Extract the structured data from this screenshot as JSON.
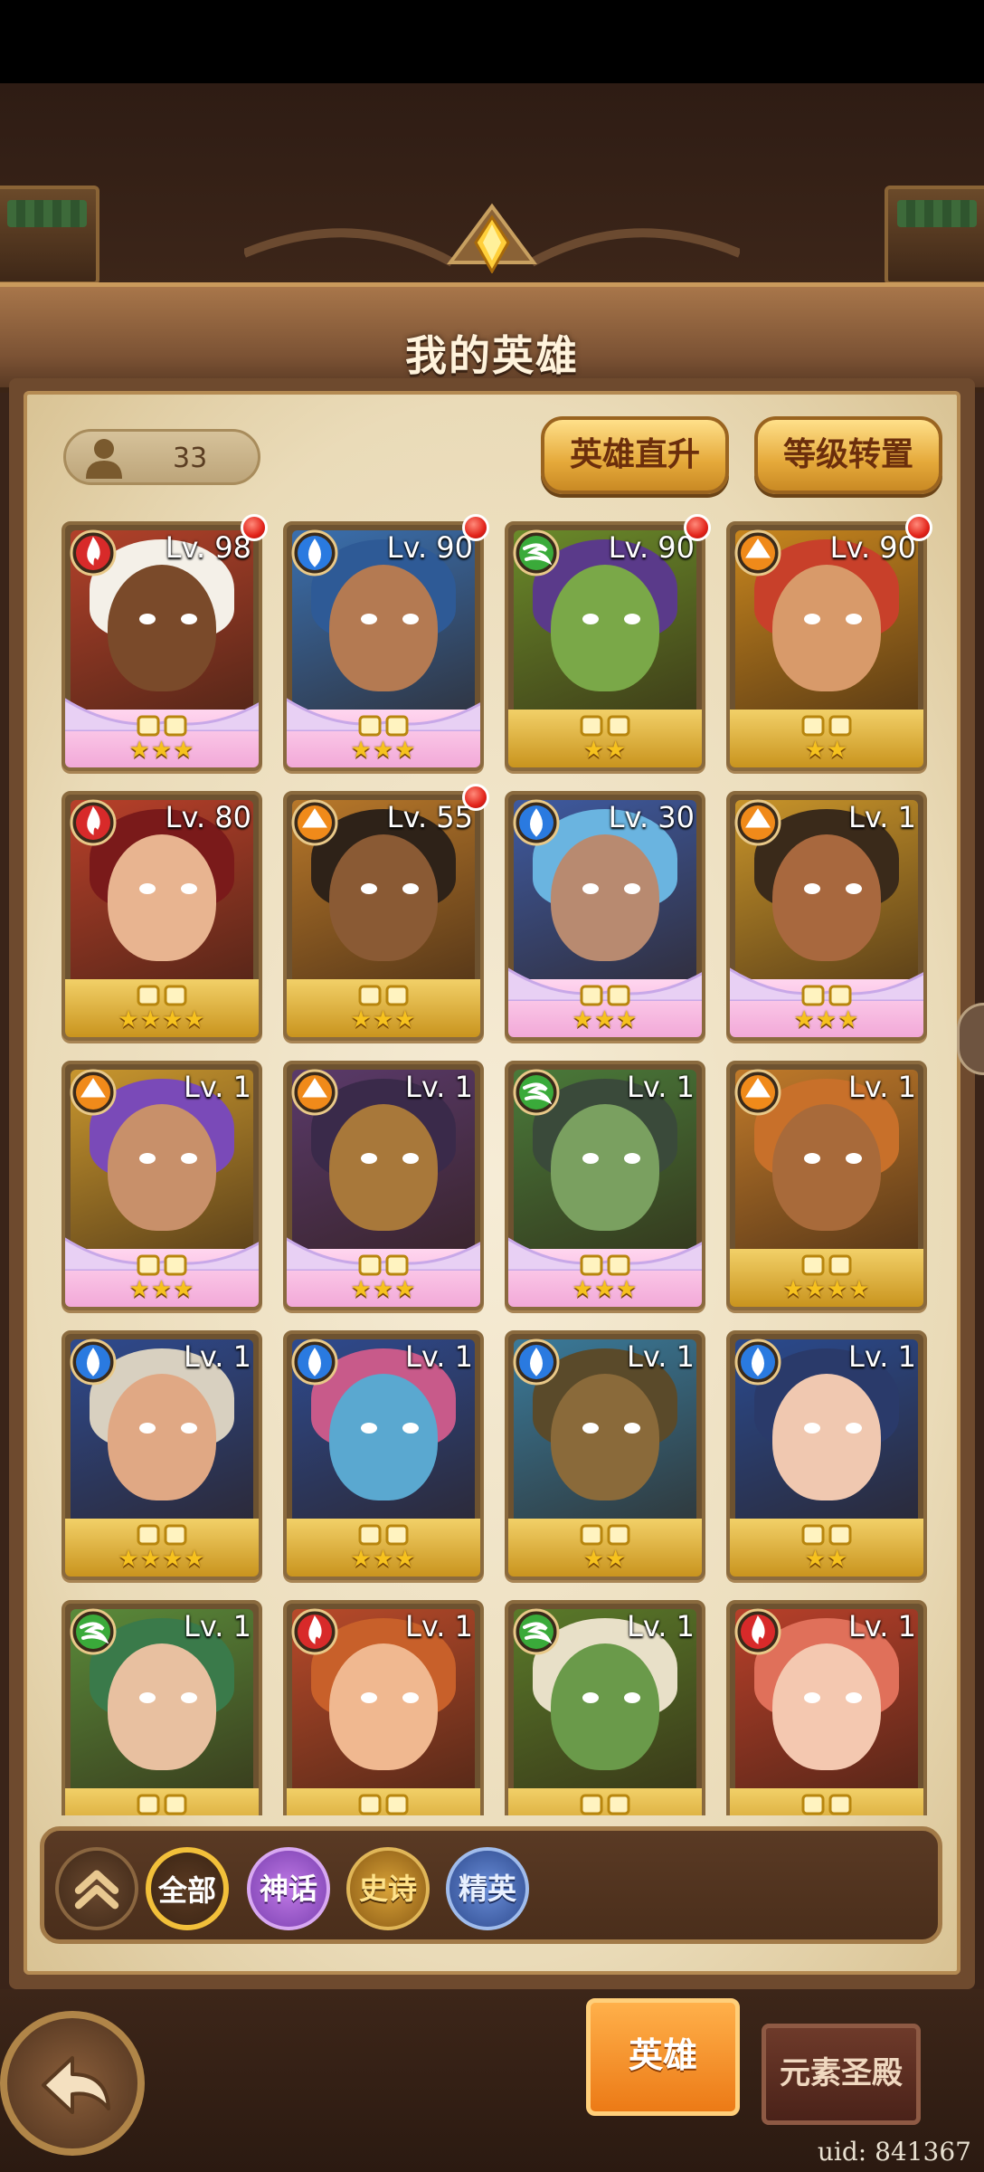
{
  "screen": {
    "title": "我的英雄",
    "hero_count": "33",
    "buttons": {
      "hero_boost": "英雄直升",
      "level_transfer": "等级转置"
    }
  },
  "heroes": [
    {
      "level": "Lv. 98",
      "element": "fire",
      "stars": "★★★",
      "frame": "pink",
      "red_dot": true,
      "palette": {
        "bg": "#b2412a",
        "face": "#7a4a2a",
        "hair": "#f4f0e8"
      }
    },
    {
      "level": "Lv. 90",
      "element": "water",
      "stars": "★★★",
      "frame": "pink",
      "red_dot": true,
      "palette": {
        "bg": "#3a6fae",
        "face": "#b47a52",
        "hair": "#2e5a96"
      }
    },
    {
      "level": "Lv. 90",
      "element": "wind",
      "stars": "★★",
      "frame": "gold",
      "red_dot": true,
      "palette": {
        "bg": "#6a8a2a",
        "face": "#7aa848",
        "hair": "#5a3a8a"
      }
    },
    {
      "level": "Lv. 90",
      "element": "earth",
      "stars": "★★",
      "frame": "gold",
      "red_dot": true,
      "palette": {
        "bg": "#c8861e",
        "face": "#d89a6a",
        "hair": "#c8402a"
      }
    },
    {
      "level": "Lv. 80",
      "element": "fire",
      "stars": "★★★★",
      "frame": "gold",
      "red_dot": false,
      "palette": {
        "bg": "#b8402a",
        "face": "#e8b490",
        "hair": "#7a1a1a"
      }
    },
    {
      "level": "Lv. 55",
      "element": "earth",
      "stars": "★★★",
      "frame": "gold",
      "red_dot": true,
      "palette": {
        "bg": "#b8782a",
        "face": "#8a5a34",
        "hair": "#2e2218"
      }
    },
    {
      "level": "Lv. 30",
      "element": "water",
      "stars": "★★★",
      "frame": "pink",
      "red_dot": false,
      "palette": {
        "bg": "#3e5aa0",
        "face": "#b88a70",
        "hair": "#6ab4e0"
      }
    },
    {
      "level": "Lv. 1",
      "element": "earth",
      "stars": "★★★",
      "frame": "pink",
      "red_dot": false,
      "palette": {
        "bg": "#c8942a",
        "face": "#a8683e",
        "hair": "#3a2a1a"
      }
    },
    {
      "level": "Lv. 1",
      "element": "earth",
      "stars": "★★★",
      "frame": "pink",
      "red_dot": false,
      "palette": {
        "bg": "#c8962e",
        "face": "#c8906a",
        "hair": "#7a4ab8"
      }
    },
    {
      "level": "Lv. 1",
      "element": "earth",
      "stars": "★★★",
      "frame": "pink",
      "red_dot": false,
      "palette": {
        "bg": "#5a3a6a",
        "face": "#a8783a",
        "hair": "#3a2a4a"
      }
    },
    {
      "level": "Lv. 1",
      "element": "wind",
      "stars": "★★★",
      "frame": "pink",
      "red_dot": false,
      "palette": {
        "bg": "#4a7a3a",
        "face": "#7aa060",
        "hair": "#3a4a3a"
      }
    },
    {
      "level": "Lv. 1",
      "element": "earth",
      "stars": "★★★★",
      "frame": "gold",
      "red_dot": false,
      "palette": {
        "bg": "#c07a2a",
        "face": "#a86a3a",
        "hair": "#c8702a"
      }
    },
    {
      "level": "Lv. 1",
      "element": "water",
      "stars": "★★★★",
      "frame": "gold",
      "red_dot": false,
      "palette": {
        "bg": "#2e4a8e",
        "face": "#e0a884",
        "hair": "#d8d0c0"
      }
    },
    {
      "level": "Lv. 1",
      "element": "water",
      "stars": "★★★",
      "frame": "gold",
      "red_dot": false,
      "palette": {
        "bg": "#2e4a8e",
        "face": "#5aa8d0",
        "hair": "#c85a8a"
      }
    },
    {
      "level": "Lv. 1",
      "element": "water",
      "stars": "★★",
      "frame": "gold",
      "red_dot": false,
      "palette": {
        "bg": "#3a7a9a",
        "face": "#8a6a3a",
        "hair": "#5a4a2a"
      }
    },
    {
      "level": "Lv. 1",
      "element": "water",
      "stars": "★★",
      "frame": "gold",
      "red_dot": false,
      "palette": {
        "bg": "#2a4a8e",
        "face": "#f0c8b0",
        "hair": "#2a3a6a"
      }
    },
    {
      "level": "Lv. 1",
      "element": "wind",
      "stars": "",
      "frame": "gold",
      "red_dot": false,
      "palette": {
        "bg": "#5a8a3a",
        "face": "#e8c0a0",
        "hair": "#3a7a4a"
      }
    },
    {
      "level": "Lv. 1",
      "element": "fire",
      "stars": "",
      "frame": "gold",
      "red_dot": false,
      "palette": {
        "bg": "#b84a2a",
        "face": "#f0b890",
        "hair": "#c8602a"
      }
    },
    {
      "level": "Lv. 1",
      "element": "wind",
      "stars": "",
      "frame": "gold",
      "red_dot": false,
      "palette": {
        "bg": "#5a7a2a",
        "face": "#6a9a4a",
        "hair": "#e8e0c8"
      }
    },
    {
      "level": "Lv. 1",
      "element": "fire",
      "stars": "",
      "frame": "gold",
      "red_dot": false,
      "palette": {
        "bg": "#b8402a",
        "face": "#f4c8b0",
        "hair": "#e0705a"
      }
    }
  ],
  "element_colors": {
    "fire": "#d82a2a",
    "water": "#2a7ae0",
    "wind": "#3aaa3a",
    "earth": "#f08a1a"
  },
  "filters": {
    "collapse_icon": "double-chevron-up-icon",
    "all": "全部",
    "mythic": "神话",
    "epic": "史诗",
    "elite": "精英"
  },
  "bottom": {
    "back_icon": "back-arrow-icon",
    "tab_hero": "英雄",
    "tab_temple": "元素圣殿",
    "uid": "uid: 841367"
  }
}
